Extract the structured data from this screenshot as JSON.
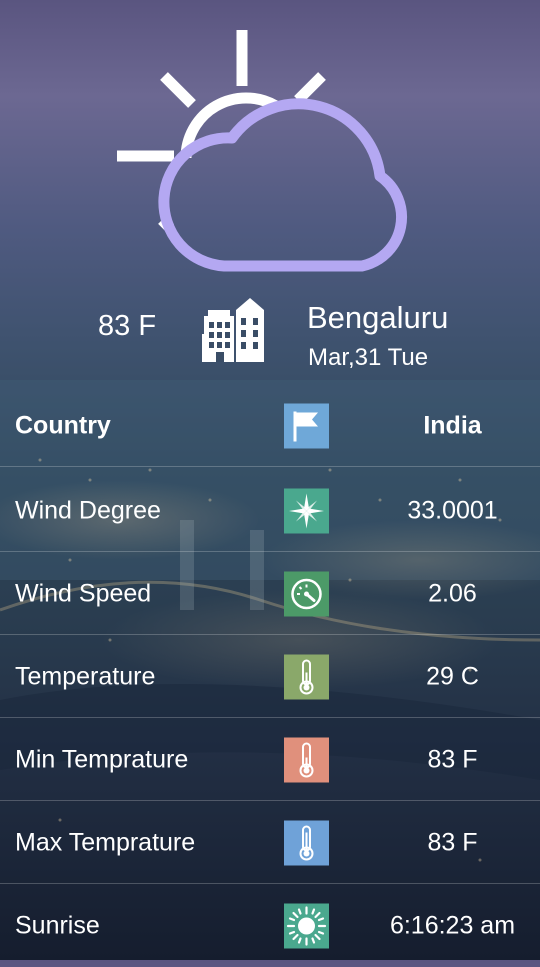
{
  "weather": {
    "condition_icon": "partly-cloudy-icon",
    "temperature": "83 F"
  },
  "location": {
    "city": "Bengaluru",
    "date": "Mar,31 Tue",
    "icon": "building-icon"
  },
  "rows": [
    {
      "label": "Country",
      "value": "India",
      "icon": "flag-icon",
      "color": "#6fa8d8"
    },
    {
      "label": "Wind Degree",
      "value": "33.0001",
      "icon": "compass-icon",
      "color": "#4aa88e"
    },
    {
      "label": "Wind Speed",
      "value": "2.06",
      "icon": "speedometer-icon",
      "color": "#4c9a68"
    },
    {
      "label": "Temperature",
      "value": "29 C",
      "icon": "thermometer-icon",
      "color": "#8aa86a"
    },
    {
      "label": "Min Temprature",
      "value": "83 F",
      "icon": "thermometer-icon",
      "color": "#e0907c"
    },
    {
      "label": "Max Temprature",
      "value": "83 F",
      "icon": "thermometer-icon",
      "color": "#6fa2d8"
    },
    {
      "label": "Sunrise",
      "value": "6:16:23 am",
      "icon": "sun-icon",
      "color": "#4aa88e"
    }
  ],
  "colors": {
    "cloud": "#b4a8f2",
    "sun": "#ffffff",
    "divider": "#ffffff"
  }
}
